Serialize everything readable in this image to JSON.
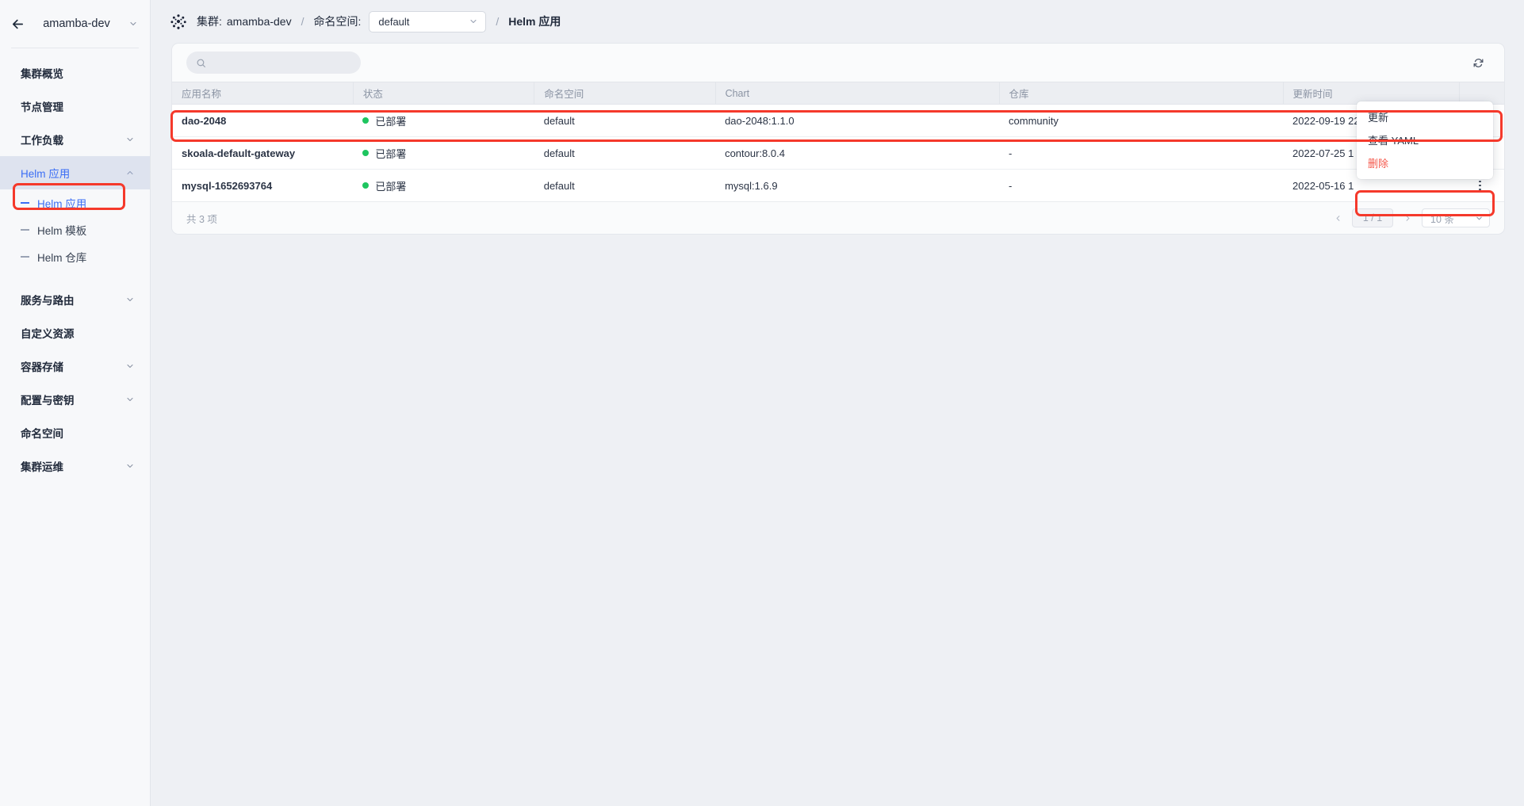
{
  "sidebar": {
    "back_icon": "arrow-left-icon",
    "cluster_name": "amamba-dev",
    "cluster_chevron": "chevron-down-icon",
    "items": [
      {
        "label": "集群概览",
        "type": "item",
        "expandable": false,
        "active": false
      },
      {
        "label": "节点管理",
        "type": "item",
        "expandable": false,
        "active": false
      },
      {
        "label": "工作负载",
        "type": "item",
        "expandable": true,
        "active": false
      },
      {
        "label": "Helm 应用",
        "type": "item",
        "expandable": true,
        "active": true
      },
      {
        "label": "Helm 应用",
        "type": "sub",
        "selected": true
      },
      {
        "label": "Helm 模板",
        "type": "sub",
        "selected": false
      },
      {
        "label": "Helm 仓库",
        "type": "sub",
        "selected": false
      },
      {
        "label": "服务与路由",
        "type": "item",
        "expandable": true,
        "active": false
      },
      {
        "label": "自定义资源",
        "type": "item",
        "expandable": false,
        "active": false
      },
      {
        "label": "容器存储",
        "type": "item",
        "expandable": true,
        "active": false
      },
      {
        "label": "配置与密钥",
        "type": "item",
        "expandable": true,
        "active": false
      },
      {
        "label": "命名空间",
        "type": "item",
        "expandable": false,
        "active": false
      },
      {
        "label": "集群运维",
        "type": "item",
        "expandable": true,
        "active": false
      }
    ]
  },
  "topbar": {
    "logo_icon": "dots-cluster-logo-icon",
    "cluster_label": "集群:",
    "cluster_value": "amamba-dev",
    "sep1": "/",
    "namespace_label": "命名空间:",
    "namespace_value": "default",
    "namespace_chevron": "chevron-down-icon",
    "sep2": "/",
    "page_title": "Helm 应用"
  },
  "toolbar": {
    "search_icon": "search-icon",
    "search_value": "",
    "search_placeholder": "",
    "refresh_icon": "refresh-icon"
  },
  "table": {
    "columns": [
      "应用名称",
      "状态",
      "命名空间",
      "Chart",
      "仓库",
      "更新时间",
      ""
    ],
    "rows": [
      {
        "name": "dao-2048",
        "status": "已部署",
        "namespace": "default",
        "chart": "dao-2048:1.1.0",
        "repo": "community",
        "updated": "2022-09-19 22:37",
        "actions_icon": "kebab-menu-icon",
        "highlighted": true
      },
      {
        "name": "skoala-default-gateway",
        "status": "已部署",
        "namespace": "default",
        "chart": "contour:8.0.4",
        "repo": "-",
        "updated": "2022-07-25 1",
        "actions_icon": "kebab-menu-icon",
        "highlighted": false
      },
      {
        "name": "mysql-1652693764",
        "status": "已部署",
        "namespace": "default",
        "chart": "mysql:1.6.9",
        "repo": "-",
        "updated": "2022-05-16 1",
        "actions_icon": "kebab-menu-icon",
        "highlighted": false
      }
    ],
    "status_dot_color": "#1ec55f"
  },
  "footer": {
    "total_text": "共 3 项",
    "prev_icon": "chevron-left-icon",
    "next_icon": "chevron-right-icon",
    "page_value": "1 / 1",
    "page_size_value": "10 条",
    "page_size_chevron": "chevron-down-icon"
  },
  "context_menu": {
    "items": [
      {
        "label": "更新",
        "danger": false
      },
      {
        "label": "查看 YAML",
        "danger": false
      },
      {
        "label": "删除",
        "danger": true
      }
    ]
  },
  "annotations": {
    "highlight_color": "#f5392b"
  }
}
